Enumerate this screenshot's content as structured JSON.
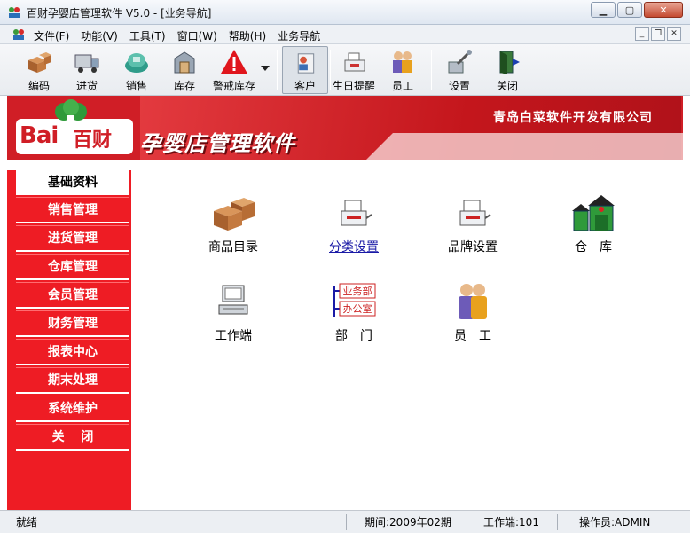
{
  "window": {
    "title": "百财孕婴店管理软件 V5.0 - [业务导航]"
  },
  "menu": [
    "文件(F)",
    "功能(V)",
    "工具(T)",
    "窗口(W)",
    "帮助(H)",
    "业务导航"
  ],
  "toolbar": [
    {
      "label": "编码",
      "icon": "boxes-icon"
    },
    {
      "label": "进货",
      "icon": "truck-icon"
    },
    {
      "label": "销售",
      "icon": "sales-icon"
    },
    {
      "label": "库存",
      "icon": "inventory-icon"
    },
    {
      "label": "警戒库存",
      "icon": "warning-icon"
    },
    {
      "label": "客户",
      "icon": "customer-icon"
    },
    {
      "label": "生日提醒",
      "icon": "birthday-icon"
    },
    {
      "label": "员工",
      "icon": "staff-icon"
    },
    {
      "label": "设置",
      "icon": "settings-icon"
    },
    {
      "label": "关闭",
      "icon": "exit-icon"
    }
  ],
  "banner": {
    "logo_latin": "Bai",
    "logo_cn": "百财",
    "product": "孕婴店管理软件",
    "company": "青岛白菜软件开发有限公司"
  },
  "sidebar": [
    {
      "label": "基础资料",
      "active": true
    },
    {
      "label": "销售管理"
    },
    {
      "label": "进货管理"
    },
    {
      "label": "仓库管理"
    },
    {
      "label": "会员管理"
    },
    {
      "label": "财务管理"
    },
    {
      "label": "报表中心"
    },
    {
      "label": "期末处理"
    },
    {
      "label": "系统维护"
    },
    {
      "label": "关　 闭"
    }
  ],
  "items": [
    {
      "label": "商品目录",
      "icon": "boxes-icon"
    },
    {
      "label": "分类设置",
      "icon": "printer-icon",
      "link": true
    },
    {
      "label": "品牌设置",
      "icon": "printer-icon"
    },
    {
      "label": "仓　库",
      "icon": "warehouse-icon"
    },
    {
      "label": "工作端",
      "icon": "computer-icon"
    },
    {
      "label": "部　门",
      "icon": "department-icon",
      "dept_labels": [
        "业务部",
        "办公室"
      ]
    },
    {
      "label": "员　工",
      "icon": "staff-icon"
    }
  ],
  "status": {
    "state": "就绪",
    "period": "期间:2009年02期",
    "terminal": "工作端:101",
    "operator": "操作员:ADMIN"
  },
  "colors": {
    "brand_red": "#ee1c24",
    "banner_red": "#d01e26",
    "link_blue": "#1a1aa6"
  }
}
